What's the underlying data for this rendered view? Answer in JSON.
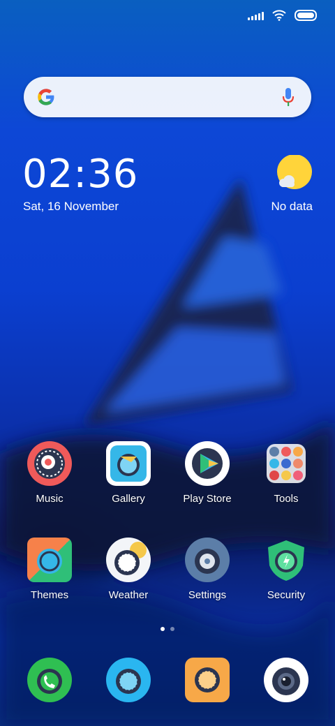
{
  "status_bar": {
    "icons": [
      "signal-icon",
      "wifi-icon",
      "battery-icon"
    ]
  },
  "search": {
    "placeholder": ""
  },
  "clock": {
    "time": "02:36",
    "date": "Sat, 16 November"
  },
  "weather": {
    "status": "No data"
  },
  "apps_row1": [
    {
      "label": "Music",
      "color": "#ef5a5a"
    },
    {
      "label": "Gallery",
      "color": "#35b7e8"
    },
    {
      "label": "Play Store",
      "color": "#ffffff"
    },
    {
      "label": "Tools",
      "color": "#e9ecf2"
    }
  ],
  "apps_row2": [
    {
      "label": "Themes",
      "color": "#f6814a"
    },
    {
      "label": "Weather",
      "color": "#f3f5f8"
    },
    {
      "label": "Settings",
      "color": "#5c7ea8"
    },
    {
      "label": "Security",
      "color": "#2fbf78"
    }
  ],
  "dock": [
    {
      "name": "phone",
      "color": "#2fbf52"
    },
    {
      "name": "browser",
      "color": "#2ab6f0"
    },
    {
      "name": "messages",
      "color": "#f7a848"
    },
    {
      "name": "camera",
      "color": "#ffffff"
    }
  ],
  "page_indicator": {
    "current": 1,
    "total": 2
  }
}
